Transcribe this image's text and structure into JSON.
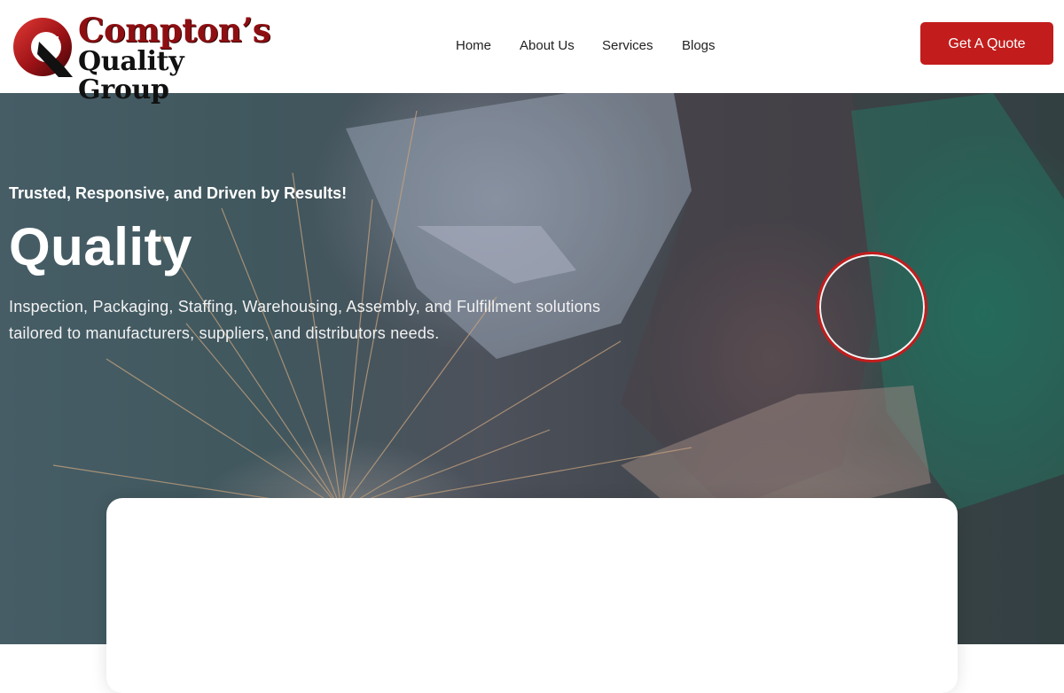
{
  "brand": {
    "line1": "Compton’s",
    "line2": "Quality Group",
    "colors": {
      "primary_red": "#c21c1c",
      "logo_red": "#8e0f12",
      "logo_dark": "#111111"
    }
  },
  "nav": {
    "items": [
      {
        "label": "Home"
      },
      {
        "label": "About Us"
      },
      {
        "label": "Services"
      },
      {
        "label": "Blogs"
      }
    ]
  },
  "header": {
    "cta_label": "Get A Quote"
  },
  "hero": {
    "tagline": "Trusted, Responsive, and Driven by Results!",
    "title": "Quality",
    "description": "Inspection, Packaging, Staffing, Warehousing, Assembly, and Fulfillment solutions tailored to manufacturers, suppliers, and distributors needs.",
    "background_image": "welder-with-sparks",
    "decor_icon": "red-ring-icon"
  }
}
